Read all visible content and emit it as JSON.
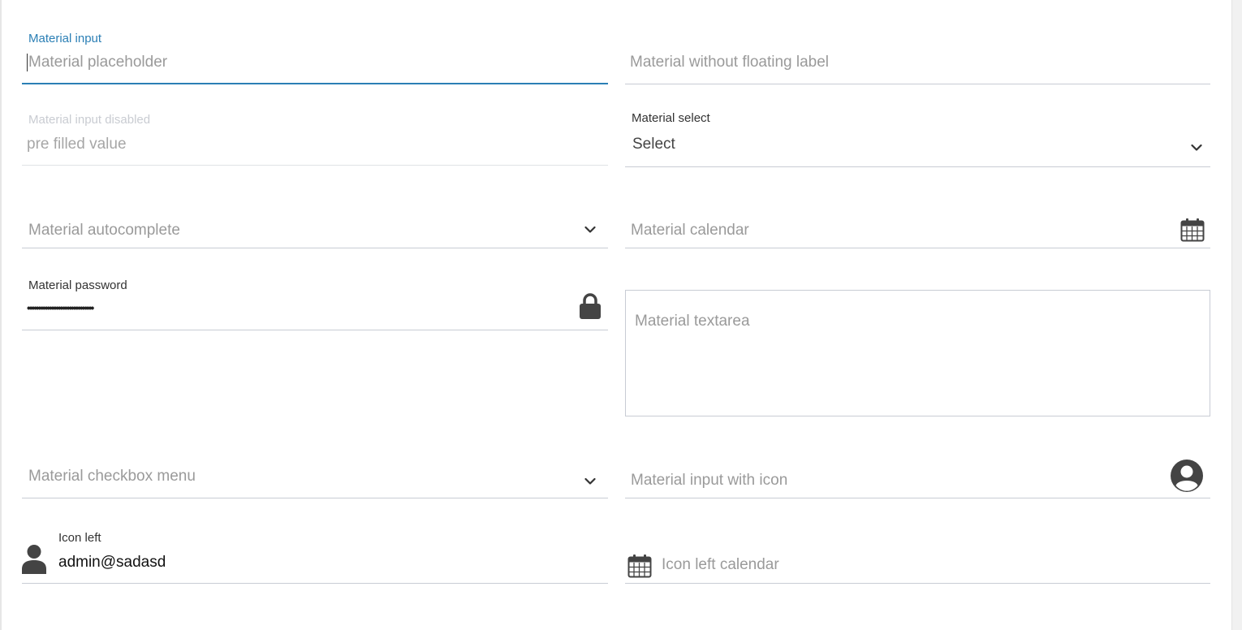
{
  "fields": {
    "material_input": {
      "label": "Material input",
      "placeholder": "Material placeholder"
    },
    "no_float": {
      "placeholder": "Material without floating label"
    },
    "disabled": {
      "label": "Material input disabled",
      "value": "pre filled value"
    },
    "select": {
      "label": "Material select",
      "value": "Select"
    },
    "autocomplete": {
      "placeholder": "Material autocomplete"
    },
    "calendar": {
      "placeholder": "Material calendar"
    },
    "password": {
      "label": "Material password",
      "value": "••••••••••••••••••••••••••••••"
    },
    "textarea": {
      "placeholder": "Material textarea"
    },
    "checkbox_menu": {
      "placeholder": "Material checkbox menu"
    },
    "input_with_icon": {
      "placeholder": "Material input with icon"
    },
    "icon_left": {
      "label": "Icon left",
      "value": "admin@sadasd"
    },
    "icon_left_calendar": {
      "placeholder": "Icon left calendar"
    }
  },
  "icons": {
    "select_arrow": "chevron-down-icon",
    "autocomplete_arrow": "chevron-down-icon",
    "checkbox_menu_arrow": "chevron-down-icon",
    "calendar": "calendar-icon",
    "password": "lock-icon",
    "input_with_icon": "user-circle-icon",
    "icon_left": "user-icon",
    "icon_left_calendar": "calendar-icon"
  },
  "colors": {
    "accent": "#2b7fb5",
    "underline": "#c8ccd4",
    "placeholder": "#9a9a9a",
    "icon": "#444444"
  }
}
